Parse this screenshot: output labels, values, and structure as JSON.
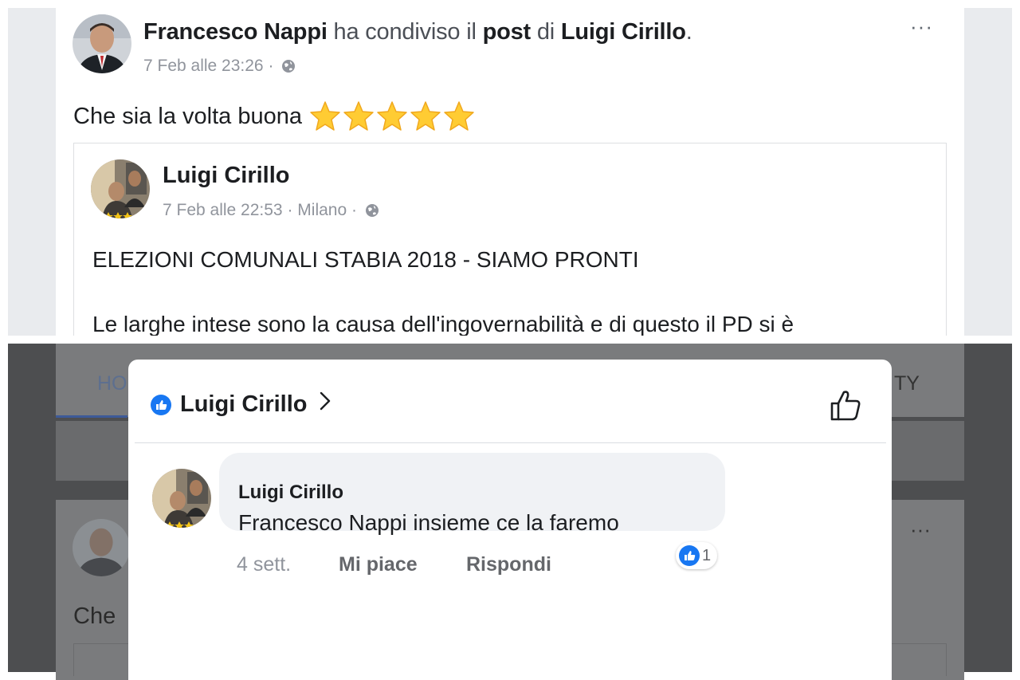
{
  "top_post": {
    "author": "Francesco Nappi",
    "shared_verb": "ha condiviso il",
    "post_word": "post",
    "of_word": "di",
    "shared_from": "Luigi Cirillo",
    "period": ".",
    "timestamp": "7 Feb alle 23:26",
    "separator": " · ",
    "privacy_icon": "globe-icon",
    "more_label": "···",
    "text": "Che sia la volta buona",
    "stars_count": 5,
    "shared_post": {
      "author": "Luigi Cirillo",
      "timestamp": "7 Feb alle 22:53",
      "location": "Milano",
      "title": "ELEZIONI COMUNALI STABIA 2018 - SIAMO PRONTI",
      "body": "Le larghe intese sono la causa dell'ingovernabilità e di questo il PD si è"
    }
  },
  "bottom_screen": {
    "background_tabs": {
      "home_partial": "HO",
      "right_partial": "TY"
    },
    "background_post": {
      "more_label": "···",
      "text_partial": "Che"
    },
    "modal": {
      "title": "Luigi Cirillo",
      "chevron_icon": "chevron-right-icon",
      "like_icon": "thumbs-up-outline-icon",
      "comment": {
        "author": "Luigi Cirillo",
        "text": "Francesco Nappi insieme ce la faremo",
        "time": "4 sett.",
        "like_label": "Mi piace",
        "reply_label": "Rispondi",
        "reaction_count": "1"
      }
    }
  },
  "colors": {
    "facebook_blue": "#1877f2",
    "star_yellow": "#ffcc33",
    "meta_gray": "#90949c",
    "bubble_bg": "#f0f2f5",
    "overlay_bg": "#4d4e50"
  }
}
